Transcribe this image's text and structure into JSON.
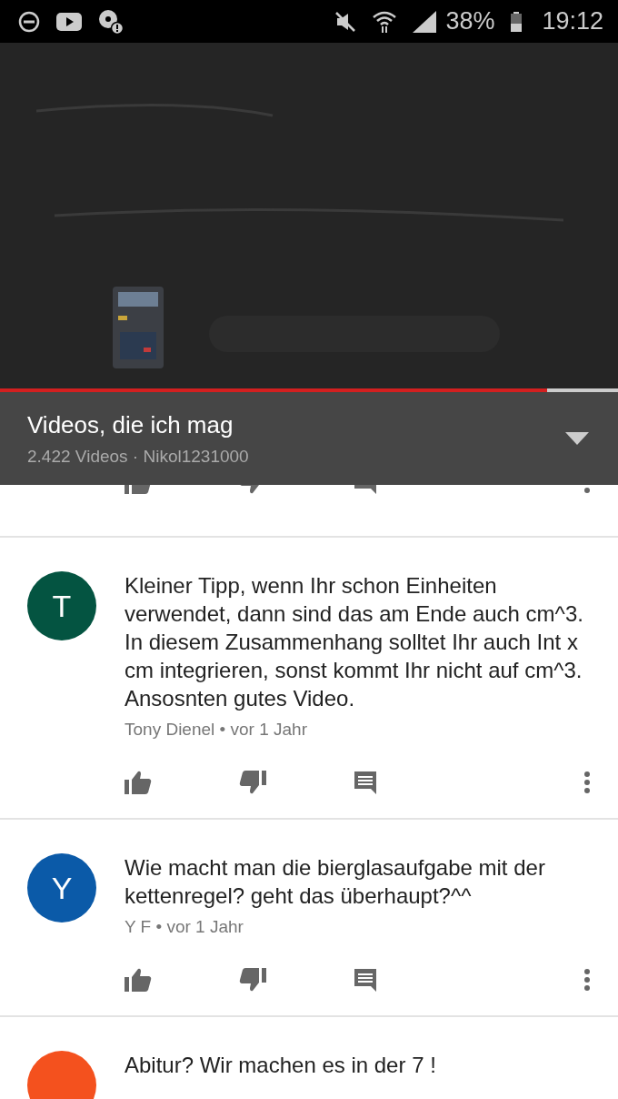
{
  "status_bar": {
    "battery": "38%",
    "time": "19:12"
  },
  "video": {
    "kind": "picture",
    "progress": {
      "level": 0.885
    }
  },
  "playlist": {
    "title": "Videos, die ich mag",
    "subtitle": "2.422 Videos · Nikol1231000"
  },
  "comments": [
    {
      "avatar_letter": "T",
      "color": "#045441",
      "text": "Kleiner Tipp, wenn Ihr schon Einheiten verwendet, dann sind das am Ende auch cm^3. In diesem Zusammenhang solltet Ihr auch Int x cm integrieren, sonst kommt Ihr nicht auf cm^3. Ansosnten gutes Video.",
      "meta": "Tony Dienel • vor 1 Jahr"
    },
    {
      "avatar_letter": "Y",
      "color": "#0b5aa8",
      "text": "Wie macht man die bierglasaufgabe mit der kettenregel? geht das überhaupt?^^",
      "meta": "Y F • vor 1 Jahr"
    },
    {
      "color": "#f4511e",
      "text": "Abitur? Wir machen es in der 7 !"
    }
  ]
}
